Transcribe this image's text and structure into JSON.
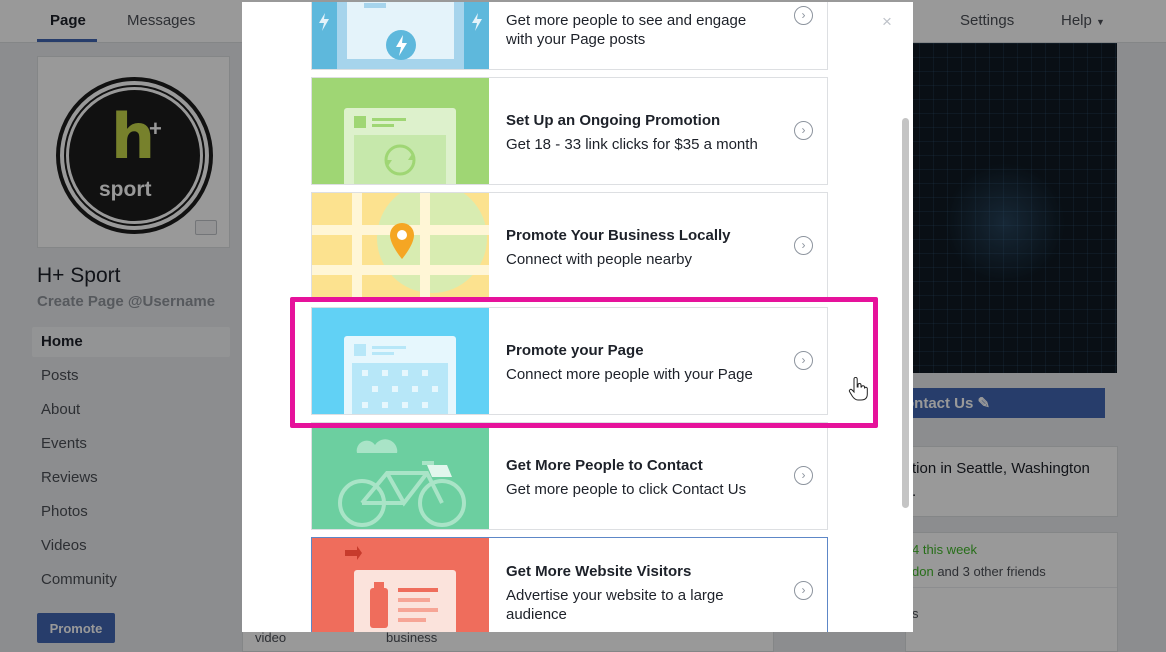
{
  "topbar": {
    "tabs": [
      "Page",
      "Messages"
    ],
    "right_tabs": [
      "Settings",
      "Help"
    ]
  },
  "profile": {
    "logo_letter": "h",
    "logo_plus": "+",
    "logo_word": "sport",
    "name": "H+ Sport",
    "username_link": "Create Page @Username"
  },
  "sidebar": {
    "items": [
      "Home",
      "Posts",
      "About",
      "Events",
      "Reviews",
      "Photos",
      "Videos",
      "Community"
    ],
    "active": "Home",
    "promote_label": "Promote"
  },
  "center": {
    "label_1": "video",
    "label_2": "business"
  },
  "right_column": {
    "contact_button": "ontact Us",
    "location_text_1": "tion in Seattle, Washington",
    "location_text_2": ".",
    "likes_text": "4 this week",
    "friends_name": "don",
    "friends_text": " and 3 other friends",
    "s_text": "s"
  },
  "dialog": {
    "close_symbol": "×",
    "options": [
      {
        "title": "",
        "description": "Get more people to see and engage with your Page posts",
        "illustration": "boost-post",
        "color": "#a6d4ec"
      },
      {
        "title": "Set Up an Ongoing Promotion",
        "description": "Get 18 - 33 link clicks for $35 a month",
        "illustration": "ongoing-promotion",
        "color": "#9fd674"
      },
      {
        "title": "Promote Your Business Locally",
        "description": "Connect with people nearby",
        "illustration": "local-map",
        "color": "#fce28f"
      },
      {
        "title": "Promote your Page",
        "description": "Connect more people with your Page",
        "illustration": "page-likes",
        "color": "#61d1f5"
      },
      {
        "title": "Get More People to Contact",
        "description": "Get more people to click Contact Us",
        "illustration": "bicycle",
        "color": "#6ccfa0"
      },
      {
        "title": "Get More Website Visitors",
        "description": "Advertise your website to a large audience",
        "illustration": "website",
        "color": "#ef6d5c"
      }
    ]
  },
  "colors": {
    "highlight": "#e6129b",
    "brand_blue": "#4267b2"
  }
}
